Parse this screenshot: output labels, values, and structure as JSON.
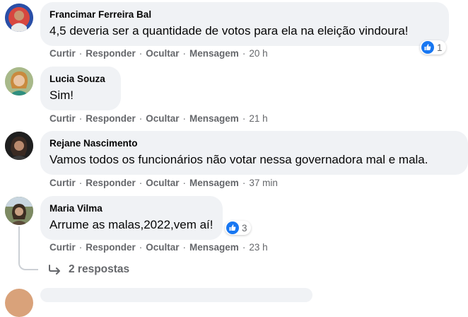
{
  "comments": [
    {
      "name": "Francimar Ferreira Bal",
      "text": "4,5 deveria ser a quantidade de votos para ela na eleição vindoura!",
      "reactions": "1",
      "time": "20 h",
      "avatar_icon": "user-avatar-icon"
    },
    {
      "name": "Lucia Souza",
      "text": "Sim!",
      "time": "21 h",
      "avatar_icon": "user-avatar-icon"
    },
    {
      "name": "Rejane Nascimento",
      "text": "Vamos todos os funcionários não votar nessa governadora mal e mala.",
      "time": "37 min",
      "avatar_icon": "user-avatar-icon"
    },
    {
      "name": "Maria Vilma",
      "text": "Arrume as malas,2022,vem aí!",
      "reactions": "3",
      "time": "23 h",
      "avatar_icon": "user-avatar-icon"
    }
  ],
  "actions": {
    "like": "Curtir",
    "reply": "Responder",
    "hide": "Ocultar",
    "message": "Mensagem",
    "separator": "·"
  },
  "replies_label": "2 respostas",
  "colors": {
    "bubble": "#f0f2f5",
    "meta_text": "#65676b",
    "like_blue": "#1877f2"
  }
}
